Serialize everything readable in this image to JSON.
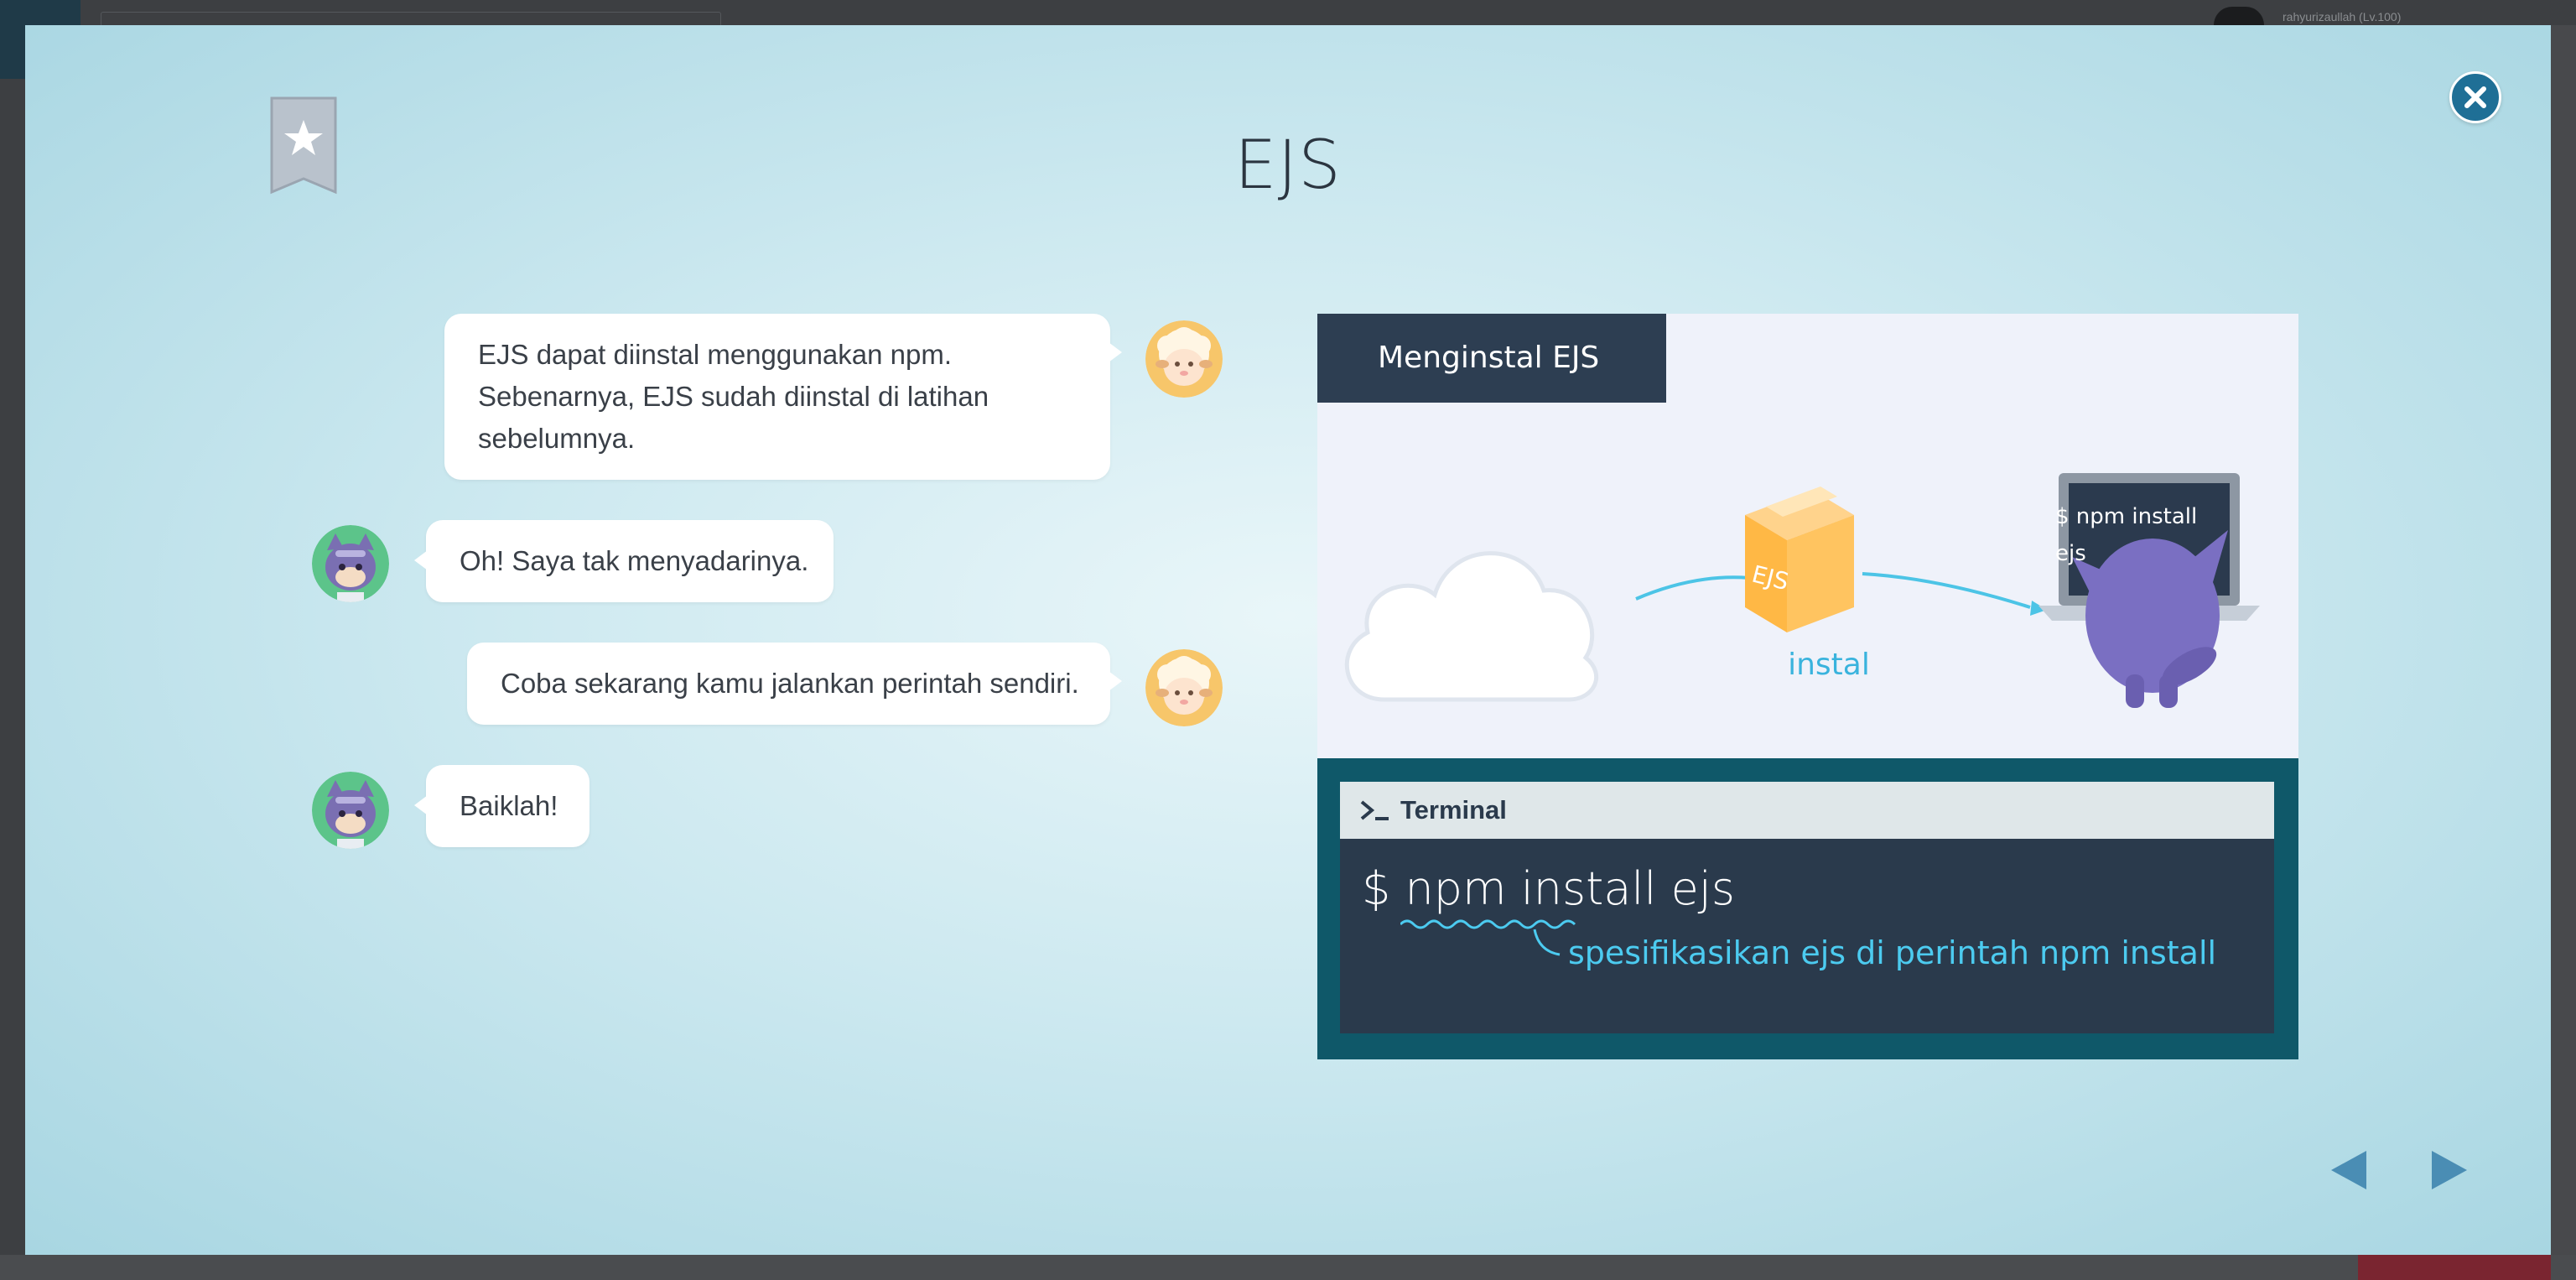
{
  "background": {
    "user_label": "rahyurizaullah (Lv.100)"
  },
  "modal": {
    "title": "EJS",
    "close_icon": "close-icon",
    "bookmark_icon": "bookmark-star-icon",
    "colors": {
      "accent": "#1f6f96",
      "panel_header": "#2d3e52",
      "terminal_frame": "#0f5869",
      "terminal_body": "#2a3a4c",
      "highlight_text": "#4ccbf0"
    }
  },
  "chat": [
    {
      "speaker": "sheep",
      "side": "right",
      "lines": [
        "EJS dapat diinstal menggunakan npm.",
        "Sebenarnya, EJS sudah diinstal di latihan",
        "sebelumnya."
      ]
    },
    {
      "speaker": "cat",
      "side": "left",
      "text": "Oh! Saya tak menyadarinya."
    },
    {
      "speaker": "sheep",
      "side": "right",
      "text": "Coba sekarang kamu jalankan perintah sendiri."
    },
    {
      "speaker": "cat",
      "side": "left",
      "text": "Baiklah!"
    }
  ],
  "illustration": {
    "header": "Menginstal EJS",
    "box_label": "EJS",
    "arrow_label": "instal",
    "laptop_lines": [
      "$ npm install",
      "ejs"
    ]
  },
  "terminal": {
    "title": "Terminal",
    "prompt_icon": "terminal-prompt-icon",
    "command": "$ npm install ejs",
    "note": "spesifikasikan ejs di perintah npm install"
  },
  "navigation": {
    "prev_icon": "arrow-left-icon",
    "next_icon": "arrow-right-icon"
  }
}
